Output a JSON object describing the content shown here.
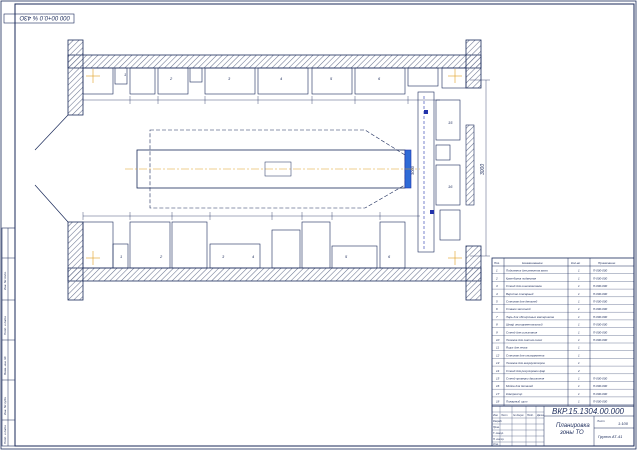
{
  "sheet": {
    "corner_code": "000 00+0.0 %  4ЗО",
    "side_labels": [
      "Инв. № подл.",
      "Подп. и дата",
      "Взам. инв. №",
      "Инв. № дубл.",
      "Подп. и дата"
    ]
  },
  "plan": {
    "bay_numbers_top": [
      "1",
      "2",
      "3",
      "4",
      "5",
      "6"
    ],
    "bay_numbers_bottom": [
      "1",
      "2",
      "3",
      "4",
      "5",
      "6"
    ],
    "dim_vertical": "3000",
    "dim_right": "3000",
    "marks": [
      "15",
      "16",
      "12",
      "3",
      "7",
      "8",
      "9",
      "10",
      "2",
      "11",
      "13",
      "4",
      "14",
      "1",
      "5",
      "17",
      "6"
    ]
  },
  "spec_table": {
    "headers": [
      "Поз.",
      "Наименование",
      "Кол-во",
      "Примечание"
    ],
    "rows": [
      {
        "pos": "1",
        "name": "Подъемник для ремонта авто",
        "qty": "1",
        "note": "П-000-000"
      },
      {
        "pos": "2",
        "name": "Кран-балка подвесная",
        "qty": "1",
        "note": "П-000-000"
      },
      {
        "pos": "3",
        "name": "Стенд для шиномонтажа",
        "qty": "1",
        "note": "П-000-000"
      },
      {
        "pos": "4",
        "name": "Верстак слесарный",
        "qty": "1",
        "note": "П-000-000"
      },
      {
        "pos": "5",
        "name": "Стеллаж для деталей",
        "qty": "1",
        "note": "П-000-000"
      },
      {
        "pos": "6",
        "name": "Станок заточной",
        "qty": "1",
        "note": "П-000-000"
      },
      {
        "pos": "7",
        "name": "Ларь для обтирочных материалов",
        "qty": "1",
        "note": "П-000-000"
      },
      {
        "pos": "8",
        "name": "Шкаф инструментальный",
        "qty": "1",
        "note": "П-000-000"
      },
      {
        "pos": "9",
        "name": "Стенд для испытания",
        "qty": "1",
        "note": "П-000-000"
      },
      {
        "pos": "10",
        "name": "Тележка для снятия колес",
        "qty": "1",
        "note": "П-000-000"
      },
      {
        "pos": "11",
        "name": "Ящик для песка",
        "qty": "1",
        "note": ""
      },
      {
        "pos": "12",
        "name": "Стеллаж для инструмента",
        "qty": "1",
        "note": ""
      },
      {
        "pos": "13",
        "name": "Тележка для аккумуляторов",
        "qty": "1",
        "note": ""
      },
      {
        "pos": "14",
        "name": "Стенд для регулировки фар",
        "qty": "2",
        "note": ""
      },
      {
        "pos": "15",
        "name": "Стенд проверки двигателя",
        "qty": "1",
        "note": "П-000-000"
      },
      {
        "pos": "16",
        "name": "Мойка для деталей",
        "qty": "1",
        "note": "П-000-000"
      },
      {
        "pos": "17",
        "name": "Компрессор",
        "qty": "1",
        "note": "П-000-000"
      },
      {
        "pos": "18",
        "name": "Пожарный щит",
        "qty": "1",
        "note": "П-000-000"
      }
    ]
  },
  "title_block": {
    "doc_code": "ВКР.15.1304.00.000",
    "title_line1": "Планировка",
    "title_line2": "зоны ТО",
    "scale": "1:100",
    "org": "Группа АТ-41",
    "sheet_label": "Лист",
    "rows_labels": [
      "Изм.",
      "Лист",
      "№ докум.",
      "Подп.",
      "Дата",
      "Разраб.",
      "Пров.",
      "Т. контр.",
      "Н. контр.",
      "Утв."
    ]
  },
  "colors": {
    "line": "#1a2a5a",
    "hatch": "#6b7590",
    "vehicle": "#2f6bd6",
    "axis": "#e0a020",
    "accent": "#2233aa"
  }
}
